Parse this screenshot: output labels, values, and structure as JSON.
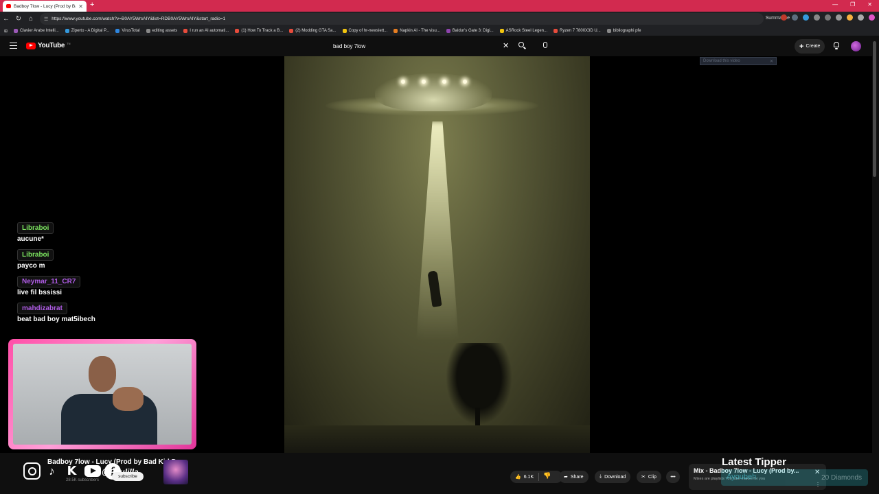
{
  "browser": {
    "tab_title": "Badboy 7low - Lucy (Prod by Bad",
    "url": "https://www.youtube.com/watch?v=B0AY5WrsAIY&list=RDB0AY5WrsAIY&start_radio=1",
    "summarise_label": "Summarise",
    "accent_color": "#d22a4f"
  },
  "bookmarks": [
    {
      "label": "Clavier Arabe Intelli...",
      "color": "#9b59b6"
    },
    {
      "label": "Ziperto - A Digital P...",
      "color": "#3498db"
    },
    {
      "label": "VirusTotal",
      "color": "#2e86de"
    },
    {
      "label": "editing assets",
      "color": "#888888"
    },
    {
      "label": "I run an AI automati...",
      "color": "#e74c3c"
    },
    {
      "label": "(1) How To Track a B...",
      "color": "#e74c3c"
    },
    {
      "label": "(2) Modding GTA Sa...",
      "color": "#e74c3c"
    },
    {
      "label": "Copy of hr-newslett...",
      "color": "#f1c40f"
    },
    {
      "label": "Napkin AI - The visu...",
      "color": "#e67e22"
    },
    {
      "label": "Baldur's Gate 3: Digi...",
      "color": "#8e44ad"
    },
    {
      "label": "ASRock Steel Legen...",
      "color": "#f1c40f"
    },
    {
      "label": "Ryzen 7 7800X3D U...",
      "color": "#e74c3c"
    },
    {
      "label": "bibliographi pfe",
      "color": "#888888"
    }
  ],
  "youtube": {
    "logo_text": "YouTube",
    "logo_tn": "TN",
    "search_value": "bad boy 7low",
    "create_label": "Create"
  },
  "download_banner": "Download this video",
  "chat": [
    {
      "user": "Libraboi",
      "message": "aucune*",
      "color": "#7be35f"
    },
    {
      "user": "Libraboi",
      "message": "payco m",
      "color": "#7be35f"
    },
    {
      "user": "Neymar_11_CR7",
      "message": "live fil bssissi",
      "color": "#b05ce6"
    },
    {
      "user": "mahdizabrat",
      "message": "beat bad boy mat5ibech",
      "color": "#b05ce6"
    }
  ],
  "video": {
    "title": "Badboy 7low - Lucy (Prod by Bad Kid D...",
    "channel_handle": "@Paulilla",
    "subscribers": "28.5K subscribers",
    "subscribe_label": "subscribe",
    "likes": "6.1K",
    "share_label": "Share",
    "download_label": "Download",
    "clip_label": "Clip"
  },
  "mix": {
    "title": "Mix - Badboy 7low - Lucy (Prod by...",
    "subtitle": "Mixes are playlists YouTube makes for you"
  },
  "overlay": {
    "latest_tipper_label": "Latest Tipper",
    "tipper_name": "Ayoubeh",
    "diamonds_label": "20 Diamonds"
  }
}
